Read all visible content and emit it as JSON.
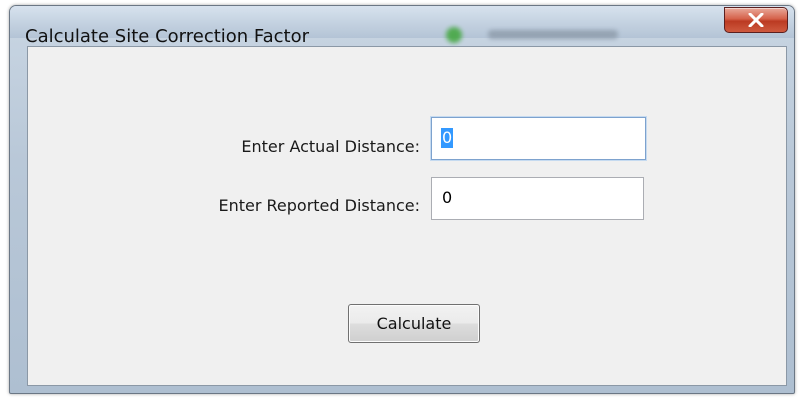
{
  "window": {
    "title": "Calculate Site Correction Factor",
    "close_icon": "close-icon"
  },
  "form": {
    "actual_label": "Enter Actual Distance:",
    "actual_value": "0",
    "reported_label": "Enter Reported Distance:",
    "reported_value": "0",
    "calculate_label": "Calculate"
  },
  "colors": {
    "close_button": "#c9452c",
    "selection": "#3399ff",
    "client_background": "#f0f0f0"
  }
}
